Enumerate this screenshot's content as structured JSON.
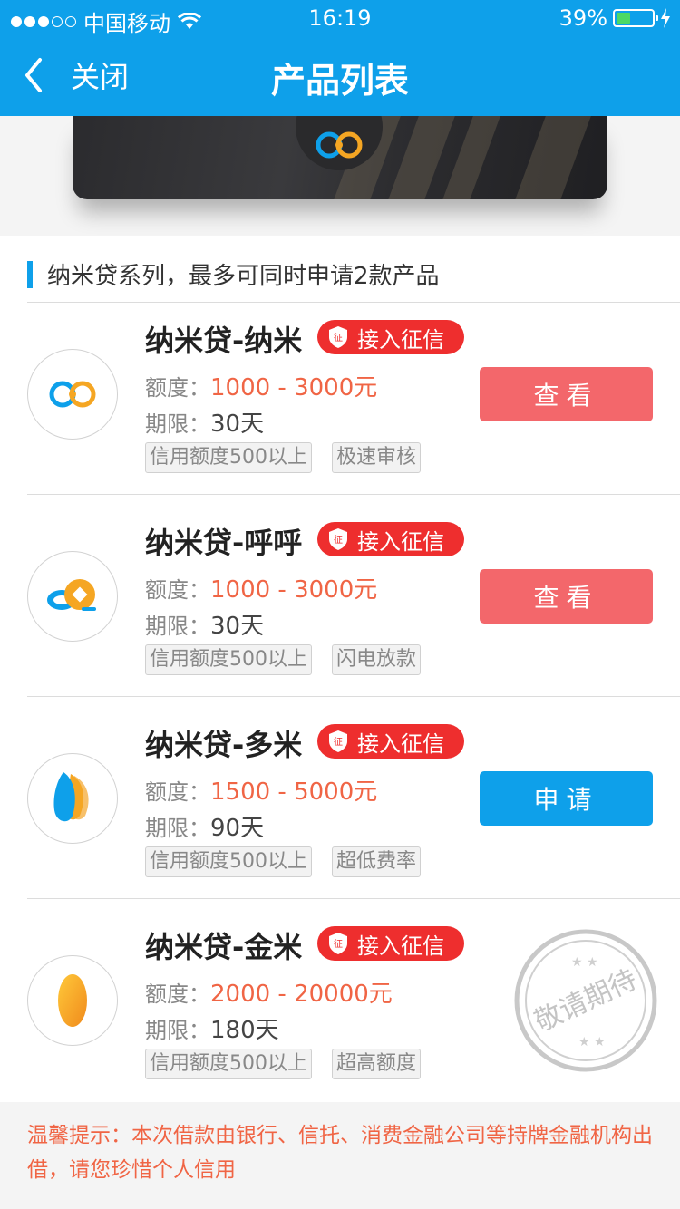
{
  "status_bar": {
    "carrier": "中国移动",
    "time": "16:19",
    "battery": "39%"
  },
  "nav": {
    "back_label": "关闭",
    "title": "产品列表"
  },
  "section": {
    "title": "纳米贷系列，最多可同时申请2款产品"
  },
  "labels": {
    "amount": "额度：",
    "term": "期限：",
    "badge": "接入征信",
    "shield_char": "征"
  },
  "products": [
    {
      "name": "纳米贷-纳米",
      "amount": "1000 - 3000元",
      "term": "30天",
      "tags": [
        "信用额度500以上",
        "极速审核"
      ],
      "action": "查看"
    },
    {
      "name": "纳米贷-呼呼",
      "amount": "1000 - 3000元",
      "term": "30天",
      "tags": [
        "信用额度500以上",
        "闪电放款"
      ],
      "action": "查看"
    },
    {
      "name": "纳米贷-多米",
      "amount": "1500 - 5000元",
      "term": "90天",
      "tags": [
        "信用额度500以上",
        "超低费率"
      ],
      "action": "申请"
    },
    {
      "name": "纳米贷-金米",
      "amount": "2000 - 20000元",
      "term": "180天",
      "tags": [
        "信用额度500以上",
        "超高额度"
      ],
      "stamp": "敬请期待"
    }
  ],
  "tip": "温馨提示：本次借款由银行、信托、消费金融公司等持牌金融机构出借，请您珍惜个人信用",
  "colors": {
    "primary": "#0ea0ea",
    "badge_red": "#ee2e2e",
    "amount_orange": "#f06545",
    "view_button": "#f3676b",
    "apply_button": "#0ea0ea"
  }
}
